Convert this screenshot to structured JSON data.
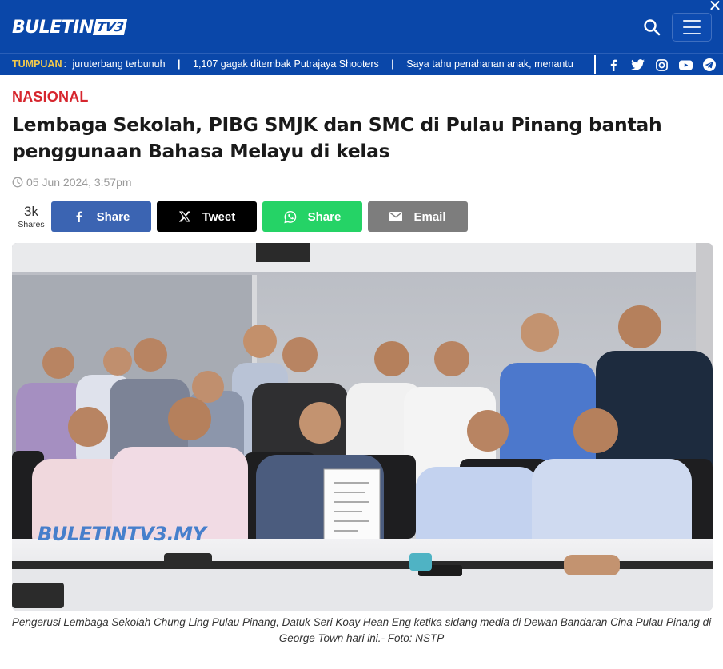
{
  "header": {
    "logo_main": "BULETIN",
    "logo_suffix": "TV3",
    "brand_color": "#0a47a9",
    "search_icon": "search-icon",
    "menu_icon": "hamburger-icon",
    "close_icon": "close-icon",
    "close_glyph": "✕"
  },
  "ticker": {
    "label": "TUMPUAN",
    "colon": ":",
    "separator": "|",
    "items": [
      "juruterbang terbunuh",
      "1,107 gagak ditembak Putrajaya Shooters",
      "Saya tahu penahanan anak, menantu"
    ],
    "label_color": "#f2c94c"
  },
  "socials": [
    "facebook-icon",
    "twitter-icon",
    "instagram-icon",
    "youtube-icon",
    "telegram-icon"
  ],
  "article": {
    "category": "NASIONAL",
    "category_color": "#d6262e",
    "headline": "Lembaga Sekolah, PIBG SMJK dan SMC di Pulau Pinang bantah penggunaan Bahasa Melayu di kelas",
    "date": "05 Jun 2024, 3:57pm",
    "share_count": "3k",
    "share_count_label": "Shares",
    "share_buttons": [
      {
        "label": "Share",
        "icon": "facebook-icon",
        "color": "#3b64b2"
      },
      {
        "label": "Tweet",
        "icon": "x-icon",
        "color": "#000000"
      },
      {
        "label": "Share",
        "icon": "whatsapp-icon",
        "color": "#25d366"
      },
      {
        "label": "Email",
        "icon": "email-icon",
        "color": "#7d7d7d"
      }
    ],
    "photo_watermark": "BULETINTV3.MY",
    "caption": "Pengerusi Lembaga Sekolah Chung Ling Pulau Pinang, Datuk Seri Koay Hean Eng ketika sidang media di Dewan Bandaran Cina Pulau Pinang di George Town hari ini.- Foto: NSTP"
  }
}
